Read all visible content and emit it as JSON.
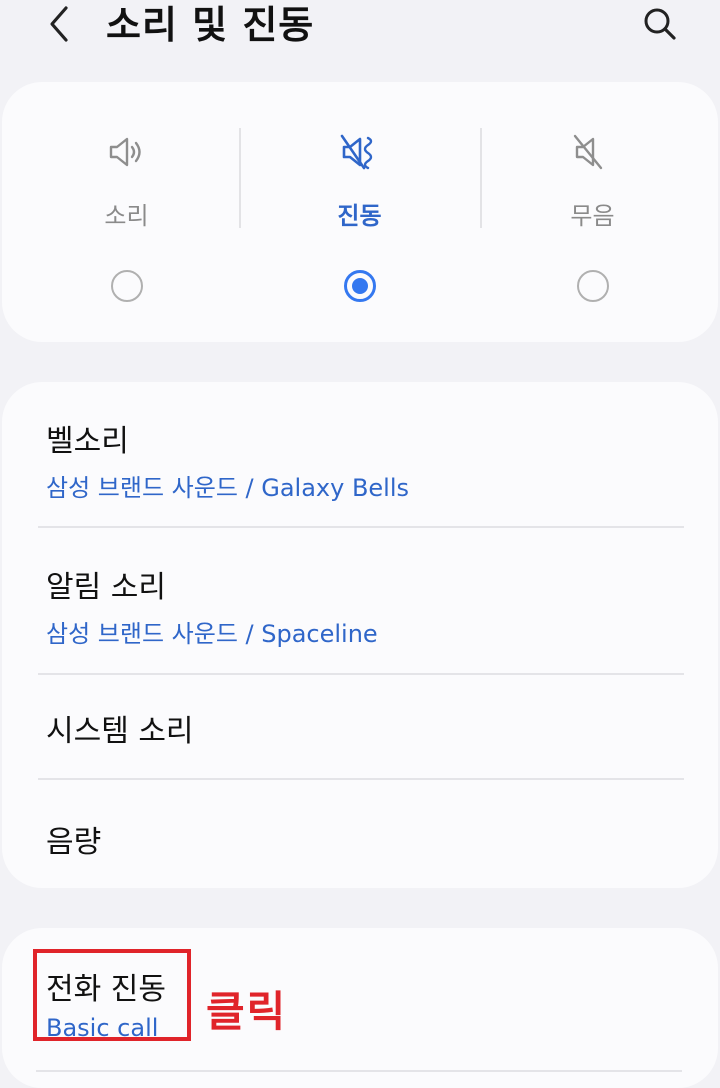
{
  "header": {
    "title": "소리 및 진동",
    "back_icon": "chevron-left-icon",
    "search_icon": "search-icon"
  },
  "sound_modes": [
    {
      "label": "소리",
      "icon": "speaker-icon",
      "selected": false
    },
    {
      "label": "진동",
      "icon": "vibrate-icon",
      "selected": true
    },
    {
      "label": "무음",
      "icon": "mute-icon",
      "selected": false
    }
  ],
  "settings": {
    "ringtone": {
      "title": "벨소리",
      "value": "삼성 브랜드 사운드 / Galaxy Bells"
    },
    "notification_sound": {
      "title": "알림 소리",
      "value": "삼성 브랜드 사운드 / Spaceline"
    },
    "system_sound": {
      "title": "시스템 소리"
    },
    "volume": {
      "title": "음량"
    },
    "call_vibration": {
      "title": "전화 진동",
      "value": "Basic call"
    }
  },
  "annotation": {
    "click_label": "클릭"
  },
  "colors": {
    "accent": "#3478f0",
    "link_text": "#2f66c9",
    "highlight": "#e0242a",
    "background": "#f2f2f6",
    "card": "#fbfbfd"
  }
}
